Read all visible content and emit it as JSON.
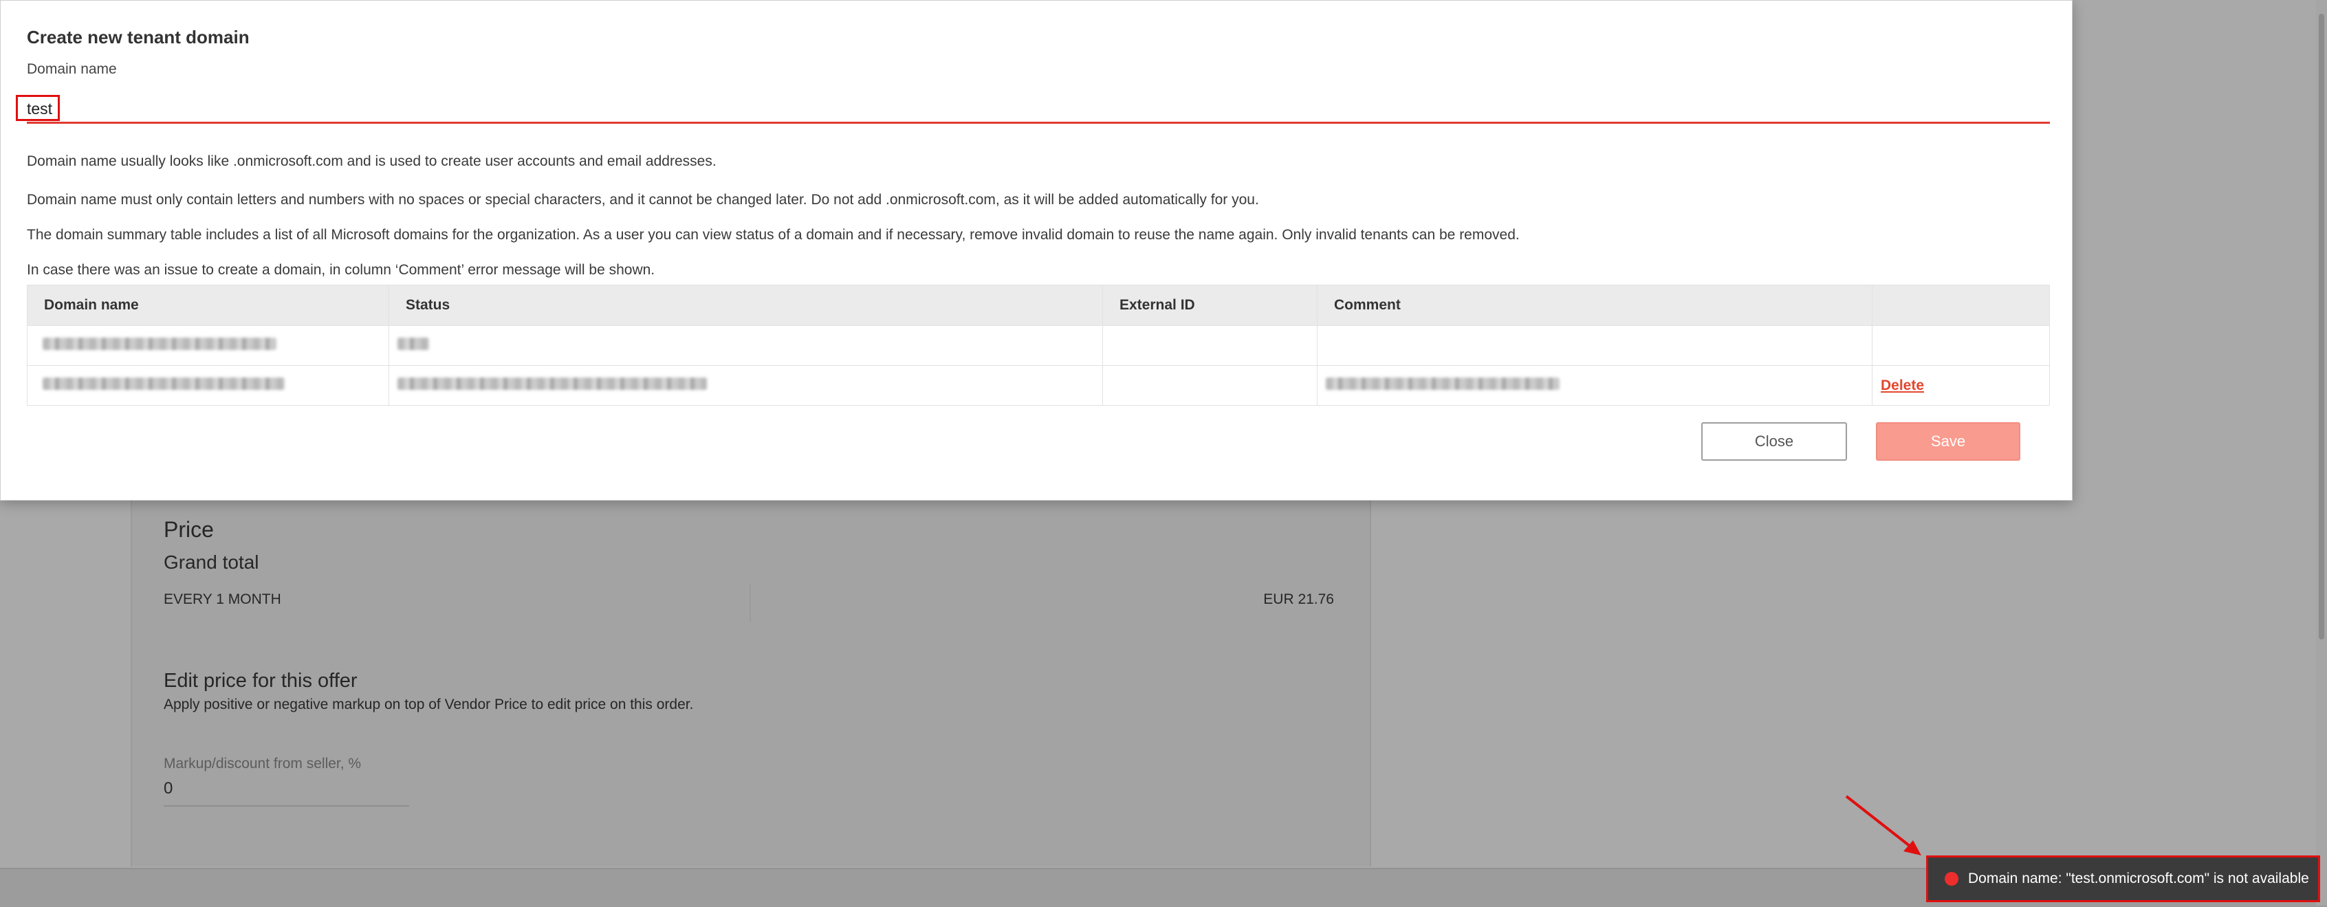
{
  "modal": {
    "title": "Create new tenant domain",
    "field_label": "Domain name",
    "input_value": "test",
    "info": [
      "Domain name usually looks like .onmicrosoft.com and is used to create user accounts and email addresses.",
      "Domain name must only contain letters and numbers with no spaces or special characters, and it cannot be changed later. Do not add .onmicrosoft.com, as it will be added automatically for you.",
      "The domain summary table includes a list of all Microsoft domains for the organization. As a user you can view status of a domain and if necessary, remove invalid domain to reuse the name again. Only invalid tenants can be removed.",
      "In case there was an issue to create a domain, in column ‘Comment’ error message will be shown."
    ],
    "table": {
      "headers": [
        "Domain name",
        "Status",
        "External ID",
        "Comment",
        ""
      ],
      "rows": [
        {
          "action": ""
        },
        {
          "action": "Delete"
        }
      ]
    },
    "close_label": "Close",
    "save_label": "Save"
  },
  "background": {
    "price_title": "Price",
    "grand_total": "Grand total",
    "period": "EVERY 1 MONTH",
    "amount": "EUR 21.76",
    "edit_title": "Edit price for this offer",
    "edit_desc": "Apply positive or negative markup on top of Vendor Price to edit price on this order.",
    "markup_label": "Markup/discount from seller, %",
    "markup_value": "0"
  },
  "toast": {
    "message": "Domain name: \"test.onmicrosoft.com\" is not available",
    "status_color": "#ee2d2d"
  },
  "colors": {
    "accent_red": "#e03a32",
    "save_button": "#f99b8e",
    "delete_link": "#e4462f"
  }
}
